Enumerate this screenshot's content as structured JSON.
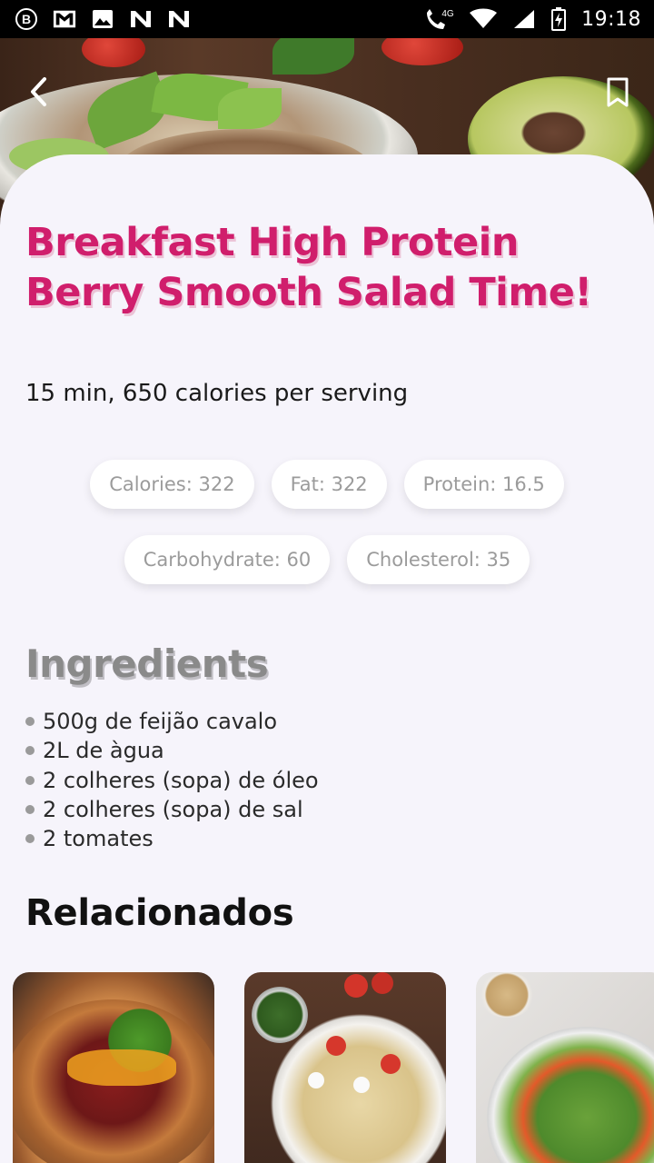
{
  "status_bar": {
    "time": "19:18",
    "network": "4G",
    "left_icons": [
      "b-circle-icon",
      "gmail-icon",
      "image-icon",
      "n-icon",
      "n-icon"
    ],
    "right_icons": [
      "call-4g-icon",
      "wifi-icon",
      "signal-icon",
      "battery-icon"
    ]
  },
  "header": {
    "back_icon": "chevron-left-icon",
    "bookmark_icon": "bookmark-icon"
  },
  "recipe": {
    "title": "Breakfast High Protein Berry Smooth Salad Time!",
    "meta": "15 min, 650 calories per serving",
    "title_color": "#d01e6c"
  },
  "nutrition": {
    "row1": [
      "Calories: 322",
      "Fat: 322",
      "Protein: 16.5"
    ],
    "row2": [
      "Carbohydrate: 60",
      "Cholesterol: 35"
    ]
  },
  "ingredients": {
    "heading": "Ingredients",
    "items": [
      "500g de feijão cavalo",
      "2L de àgua",
      "2 colheres (sopa) de óleo",
      "2 colheres (sopa) de sal",
      "2 tomates"
    ]
  },
  "related": {
    "heading": "Relacionados",
    "cards": [
      "bean-salad-image",
      "pasta-salad-image",
      "green-salad-image"
    ]
  }
}
